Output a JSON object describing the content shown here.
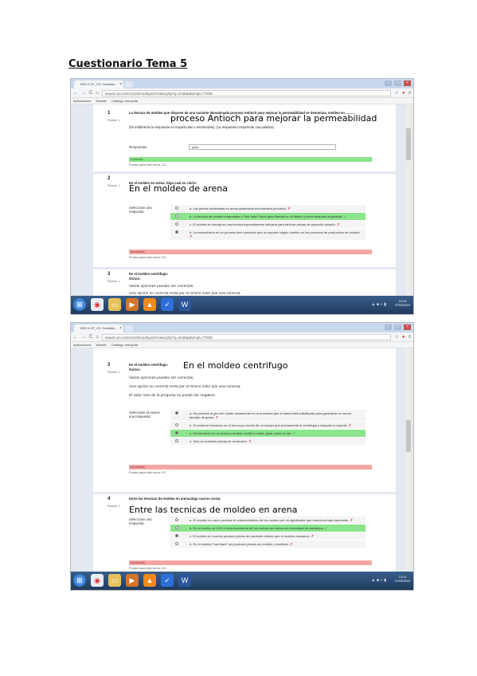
{
  "document": {
    "title": "Cuestionario Tema 5"
  },
  "browser": {
    "tab_title": "IDIS 2-CF_C2: Cuestión...",
    "tab_close": "×",
    "nav_back": "←",
    "nav_forward": "→",
    "nav_reload": "C",
    "nav_home": "⌂",
    "url": "www3.uco.es/m1415/mod/quiz/review.php?q=2446&attempt=77829",
    "bookmarks": [
      "Aplicaciones",
      "Moodle",
      "Catálogo mezquita"
    ]
  },
  "screenshot1": {
    "q1": {
      "number": "1",
      "points": "Puntúa: 1",
      "text": "La técnica de moldeo que dispone de una variante denominada proceso Antioch para mejorar la permeabilidad se denomina, moldeo en ..........",
      "overlay": "proceso Antioch para mejorar la permeabilidad",
      "hint": "(Es indiferente la respuesta en mayúsculas o minúsculas). (La respuesta comprende una palabra)",
      "answer_label": "Respuesta:",
      "answer_value": "yeso",
      "feedback": "Correcto",
      "score": "Puntos para este envío: 1/1."
    },
    "q2": {
      "number": "2",
      "points": "Puntúa: 1",
      "text": "En el moldeo en arena. Diga cual es cierto:",
      "overlay": "En el moldeo de arena",
      "select_label": "Seleccione una respuesta:",
      "options": [
        {
          "text": "a. Las piezas moldeadas en arena garantizan una elevada precisión.",
          "mark": "✗",
          "state": "none"
        },
        {
          "text": "b. La técnica de modelo evaporable o \"lost foam\" tiene gran libertad en el diseño y buen acabado superficial.",
          "mark": "✓",
          "state": "correct"
        },
        {
          "text": "c. El moldeo en terraja es una técnica especialmente indicada para fabricar piezas de pequeño tamaño.",
          "mark": "✗",
          "state": "none"
        },
        {
          "text": "d. La macrofusión es un proceso bien conocido que no supone ningún cambio en los procesos de producción de moldeo.",
          "mark": "✗",
          "state": "selected"
        }
      ],
      "feedback": "Incorrecto",
      "score": "Puntos para este envío: 0/1."
    },
    "q3": {
      "number": "3",
      "points": "Puntúa: 1",
      "text": "En el moldeo centrifugo:",
      "notes": "Notas:",
      "line1": "Varias opciones pueden ser correctas.",
      "line2": "Una opción no correcta resta por el mismo valor que una correcta."
    },
    "clock_time": "13:13",
    "clock_date": "07/05/2015"
  },
  "screenshot2": {
    "q3": {
      "number": "3",
      "points": "Puntúa: 1",
      "text": "En el moldeo centrifugo:",
      "overlay": "En el moldeo centrifugo",
      "notes": "Notas:",
      "lines": [
        "Varias opciones pueden ser correctas.",
        "Una opción no correcta resta por el mismo valor que una correcta.",
        "El valor neto de la pregunta no puede ser negativo."
      ],
      "select_label": "Seleccione al menos una respuesta:",
      "options": [
        {
          "text": "a. Se produce el giro del molde únicamente en el momento que el metal está solidificado para garantizar un menor tamaño de grano.",
          "mark": "✗",
          "state": "selected"
        },
        {
          "text": "b. El metal se introduce en el horno por medio de un equipo que previamente le centrifuga y después lo inyecta.",
          "mark": "✗",
          "state": "none"
        },
        {
          "text": "c. Se introduce en un molde y ambos, molde y metal, giran sobre un eje.",
          "mark": "✓",
          "state": "correct"
        },
        {
          "text": "d. Sólo se moldean piezas de revolución.",
          "mark": "✗",
          "state": "none"
        }
      ],
      "feedback": "Incorrecto",
      "score": "Puntos para este envío: 0/1."
    },
    "q4": {
      "number": "4",
      "points": "Puntúa: 1",
      "text": "Entre las técnicas de moldeo en arena.Diga cual es cierta:",
      "overlay": "Entre las tecnicas de moldeo en arena",
      "select_label": "Seleccione una respuesta:",
      "options": [
        {
          "text": "a. El moldeo en vacío produce el endurecimiento de los moldes por un aglutinante que reacciona bajo depresión.",
          "mark": "✗",
          "state": "none"
        },
        {
          "text": "b. En el moldeo al CO2 el endurecimiento de los moldes se realiza sin necesidad de estufados.",
          "mark": "✓",
          "state": "correct"
        },
        {
          "text": "c. El moldeo en concha produce piezas de precisión inferior que el moldeo mecánico.",
          "mark": "✗",
          "state": "selected"
        },
        {
          "text": "d. En el moldeo \"lost foam\" se producen piezas sin modelo o modelos.",
          "mark": "✗",
          "state": "none"
        }
      ],
      "feedback": "Incorrecto",
      "score": "Puntos para este envío: 0/1."
    },
    "clock_time": "13:14",
    "clock_date": "07/05/2015"
  },
  "icons": {
    "start": "windows-start-icon",
    "chrome": "chrome-icon",
    "explorer": "folder-icon",
    "media": "media-player-icon",
    "vlc": "vlc-icon",
    "check": "check-app-icon",
    "word": "word-icon"
  },
  "colors": {
    "correct": "#8ce48c",
    "incorrect": "#f4a6a6",
    "taskbar": "#1f3a5c"
  }
}
